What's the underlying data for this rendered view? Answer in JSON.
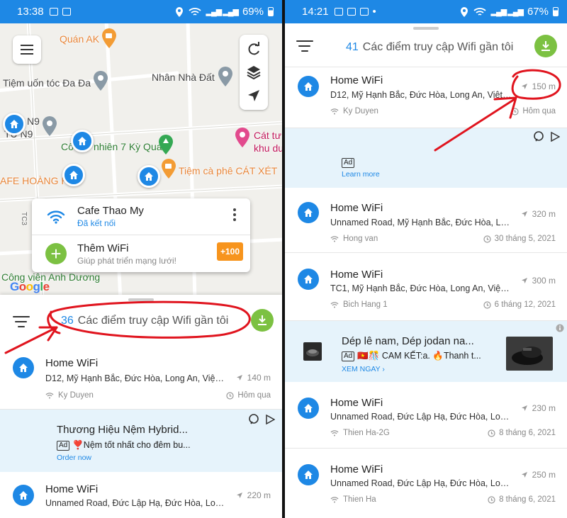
{
  "left": {
    "status": {
      "time": "13:38",
      "battery": "69%"
    },
    "map": {
      "labels": [
        "Quán AK",
        "Nhân Nhà Đất",
        "Tiệm uốn tóc Đa Đa",
        "Tiệm cà phê CÁT XÉT",
        "Cát tư",
        "khu du",
        "Công viên Anh Dương",
        "AFE HOÀNG HA",
        "N9",
        "TÚ N9",
        "Cô",
        "nhiên 7 Kỳ Quan",
        "TC3"
      ],
      "google": "Google"
    },
    "popup": {
      "name": "Cafe Thao My",
      "status": "Đã kết nối",
      "add_title": "Thêm WiFi",
      "add_sub": "Giúp phát triển mạng lưới!",
      "bonus": "+100"
    },
    "header": {
      "count": "36",
      "title": "Các điểm truy cập Wifi gần tôi"
    },
    "items": [
      {
        "name": "Home WiFi",
        "address": "D12, Mỹ Hạnh Bắc, Đức Hòa, Long An, Việt N...",
        "distance": "140 m",
        "user": "Ky Duyen",
        "date": "Hôm qua"
      }
    ],
    "ad": {
      "title": "Thương Hiệu Nệm Hybrid...",
      "tag": "Ad",
      "text": "❣️Nệm tốt nhất cho đêm bu...",
      "link": "Order now"
    },
    "items2": [
      {
        "name": "Home WiFi",
        "address": "Unnamed Road, Đức Lập Hạ, Đức Hòa, Long...",
        "distance": "220 m"
      }
    ]
  },
  "right": {
    "status": {
      "time": "14:21",
      "battery": "67%"
    },
    "header": {
      "count": "41",
      "title": "Các điểm truy cập Wifi gần tôi"
    },
    "first": {
      "name": "Home WiFi",
      "address": "D12, Mỹ Hạnh Bắc, Đức Hòa, Long An, Việt N...",
      "distance": "150 m",
      "user": "Ky Duyen",
      "date": "Hôm qua"
    },
    "ad1": {
      "tag": "Ad",
      "link": "Learn more"
    },
    "items": [
      {
        "name": "Home WiFi",
        "address": "Unnamed Road, Mỹ Hạnh Bắc, Đức Hòa, Lon...",
        "distance": "320 m",
        "user": "Hong van",
        "date": "30 tháng 5, 2021"
      },
      {
        "name": "Home WiFi",
        "address": "TC1, Mỹ Hạnh Bắc, Đức Hòa, Long An, Việt N...",
        "distance": "300 m",
        "user": "Bich Hang 1",
        "date": "6 tháng 12, 2021"
      }
    ],
    "ad2": {
      "title": "Dép lê nam, Dép jodan na...",
      "tag": "Ad",
      "text": "🇻🇳🎊 CAM KẾT:a. 🔥Thanh t...",
      "link": "XEM NGAY ›"
    },
    "items2": [
      {
        "name": "Home WiFi",
        "address": "Unnamed Road, Đức Lập Hạ, Đức Hòa, Long...",
        "distance": "230 m",
        "user": "Thien Ha-2G",
        "date": "8 tháng 6, 2021"
      },
      {
        "name": "Home WiFi",
        "address": "Unnamed Road, Đức Lập Hạ, Đức Hòa, Long...",
        "distance": "250 m",
        "user": "Thien Ha",
        "date": "8 tháng 6, 2021"
      }
    ]
  },
  "colors": {
    "primary": "#1e88e5",
    "green": "#7cc142",
    "orange": "#f7941d",
    "annotation": "#e0141e",
    "ad_bg": "#e6f3fb"
  },
  "icons": [
    "menu-icon",
    "refresh-icon",
    "layers-icon",
    "lock-icon",
    "navigation-icon",
    "wifi-icon",
    "plus-icon",
    "kebab-icon",
    "filter-icon",
    "download-icon",
    "home-icon",
    "clock-icon",
    "adchoices-icon"
  ]
}
